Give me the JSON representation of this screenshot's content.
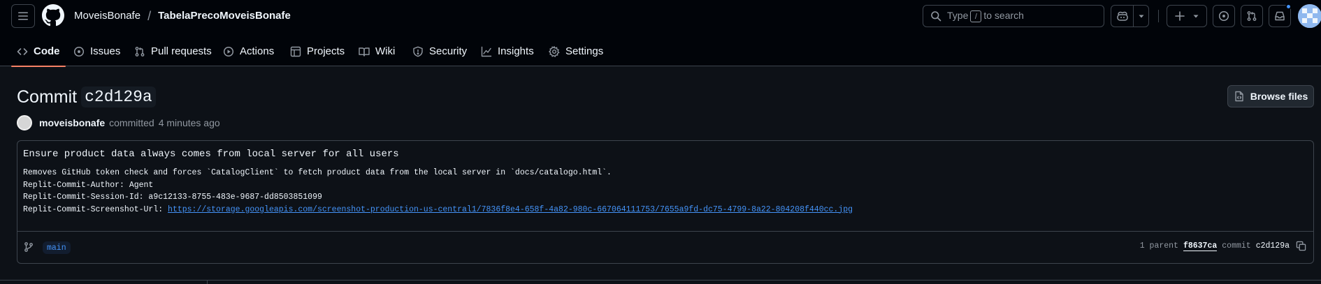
{
  "header": {
    "owner": "MoveisBonafe",
    "separator": "/",
    "repo": "TabelaPrecoMoveisBonafe",
    "search": {
      "prefix": "Type",
      "key": "/",
      "suffix": "to search"
    },
    "icons": [
      "hamburger-icon",
      "github-logo-icon",
      "search-icon",
      "copilot-icon",
      "triangle-down-icon",
      "plus-icon",
      "issue-opened-icon",
      "git-pull-request-icon",
      "inbox-icon"
    ],
    "notification_dot_color": "#4493f8"
  },
  "tabs": [
    {
      "label": "Code",
      "icon": "code-icon",
      "active": true
    },
    {
      "label": "Issues",
      "icon": "issue-opened-icon"
    },
    {
      "label": "Pull requests",
      "icon": "git-pull-request-icon"
    },
    {
      "label": "Actions",
      "icon": "play-icon"
    },
    {
      "label": "Projects",
      "icon": "table-icon"
    },
    {
      "label": "Wiki",
      "icon": "book-icon"
    },
    {
      "label": "Security",
      "icon": "shield-icon"
    },
    {
      "label": "Insights",
      "icon": "graph-icon"
    },
    {
      "label": "Settings",
      "icon": "gear-icon"
    }
  ],
  "commit": {
    "title_word": "Commit",
    "short_sha": "c2d129a",
    "browse_label": "Browse files",
    "author": "moveisbonafe",
    "action": "committed",
    "time": "4 minutes ago",
    "message_title": "Ensure product data always comes from local server for all users",
    "message_lines": [
      "Removes GitHub token check and forces `CatalogClient` to fetch product data from the local server in `docs/catalogo.html`.",
      "",
      "Replit-Commit-Author: Agent",
      "Replit-Commit-Session-Id: a9c12133-8755-483e-9687-dd8503851099"
    ],
    "screenshot_label": "Replit-Commit-Screenshot-Url: ",
    "screenshot_url": "https://storage.googleapis.com/screenshot-production-us-central1/7836f8e4-658f-4a82-980c-667064111753/7655a9fd-dc75-4799-8a22-804208f440cc.jpg",
    "branch": "main",
    "parent_count_text": "1 parent",
    "parent_sha": "f8637ca",
    "commit_label": "commit",
    "commit_sha": "c2d129a"
  },
  "colors": {
    "background": "#0d1117",
    "header_background": "#010409",
    "border": "#3d444d",
    "accent_underline": "#f78166",
    "link": "#4493f8"
  }
}
